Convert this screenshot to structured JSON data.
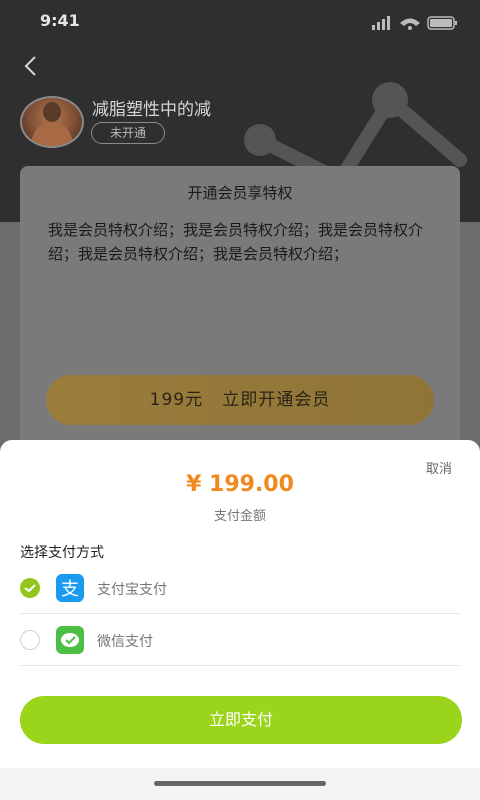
{
  "status_bar": {
    "time": "9:41"
  },
  "profile": {
    "name": "减脂塑性中的减",
    "badge": "未开通"
  },
  "card": {
    "title": "开通会员享特权",
    "description": "我是会员特权介绍；我是会员特权介绍；我是会员特权介绍；我是会员特权介绍；我是会员特权介绍；",
    "cta_price": "199元",
    "cta_label": "立即开通会员"
  },
  "sheet": {
    "cancel": "取消",
    "amount": "¥ 199.00",
    "amount_label": "支付金额",
    "method_title": "选择支付方式",
    "methods": [
      {
        "label": "支付宝支付",
        "selected": true,
        "icon": "alipay-icon"
      },
      {
        "label": "微信支付",
        "selected": false,
        "icon": "wechat-pay-icon"
      }
    ],
    "pay_button": "立即支付"
  },
  "colors": {
    "accent_green": "#9ad41b",
    "price_orange": "#f08a1e",
    "alipay_blue": "#1a9bf0",
    "wechat_green": "#4cbf45"
  }
}
